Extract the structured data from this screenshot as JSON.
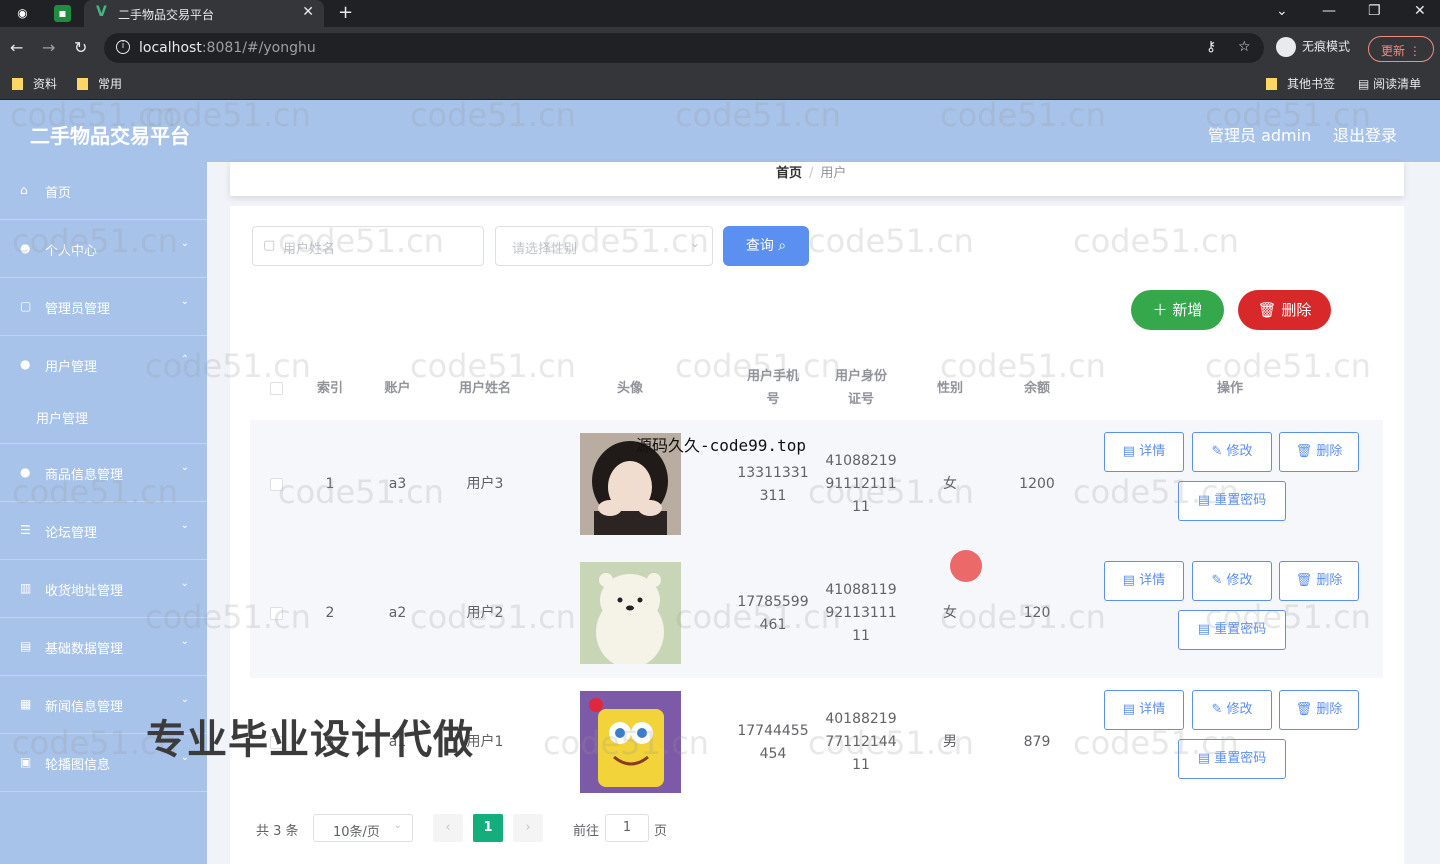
{
  "browser": {
    "tab_title": "二手物品交易平台",
    "url_host": "localhost",
    "url_rest": ":8081/#/yonghu",
    "incognito_label": "无痕模式",
    "update_label": "更新",
    "bookmarks": [
      "资料",
      "常用"
    ],
    "other_bookmarks": "其他书签",
    "reading_list": "阅读清单"
  },
  "header": {
    "title": "二手物品交易平台",
    "user": "管理员 admin",
    "logout": "退出登录"
  },
  "sidebar": {
    "items": [
      {
        "label": "首页",
        "icon": "home-icon"
      },
      {
        "label": "个人中心",
        "icon": "user-icon"
      },
      {
        "label": "管理员管理",
        "icon": "folder-icon"
      },
      {
        "label": "用户管理",
        "icon": "users-icon"
      },
      {
        "label": "商品信息管理",
        "icon": "user-icon"
      },
      {
        "label": "论坛管理",
        "icon": "list-icon"
      },
      {
        "label": "收货地址管理",
        "icon": "bar-chart-icon"
      },
      {
        "label": "基础数据管理",
        "icon": "chart-icon"
      },
      {
        "label": "新闻信息管理",
        "icon": "document-icon"
      },
      {
        "label": "轮播图信息",
        "icon": "image-icon"
      }
    ],
    "sub_item": "用户管理"
  },
  "breadcrumb": {
    "home": "首页",
    "separator": "/",
    "current": "用户"
  },
  "search": {
    "name_placeholder": "用户姓名",
    "gender_placeholder": "请选择性别",
    "query_label": "查询"
  },
  "actions": {
    "add_label": "新增",
    "delete_label": "删除"
  },
  "table": {
    "headers": {
      "index": "索引",
      "account": "账户",
      "name": "用户姓名",
      "avatar": "头像",
      "phone": [
        "用户手机",
        "号"
      ],
      "idcard": [
        "用户身份",
        "证号"
      ],
      "gender": "性别",
      "balance": "余额",
      "ops": "操作"
    },
    "rows": [
      {
        "index": "1",
        "account": "a3",
        "name": "用户3",
        "phone": [
          "13311331",
          "311"
        ],
        "idcard": [
          "41088219",
          "91112111",
          "11"
        ],
        "gender": "女",
        "balance": "1200",
        "avatar": "girl"
      },
      {
        "index": "2",
        "account": "a2",
        "name": "用户2",
        "phone": [
          "17785599",
          "461"
        ],
        "idcard": [
          "41088119",
          "92113111",
          "11"
        ],
        "gender": "女",
        "balance": "120",
        "avatar": "bear"
      },
      {
        "index": "3",
        "account": "a1",
        "name": "用户1",
        "phone": [
          "17744455",
          "454"
        ],
        "idcard": [
          "40188219",
          "77112144",
          "11"
        ],
        "gender": "男",
        "balance": "879",
        "avatar": "sponge"
      }
    ],
    "row_buttons": {
      "detail": "详情",
      "edit": "修改",
      "delete": "删除",
      "reset": "重置密码"
    }
  },
  "pagination": {
    "total": "共 3 条",
    "page_size": "10条/页",
    "current": "1",
    "goto_prefix": "前往",
    "goto_value": "1",
    "goto_suffix": "页"
  },
  "overlays": {
    "source_text": "源码久久-code99.top",
    "promo_text": "专业毕业设计代做",
    "watermark": "code51.cn"
  },
  "colors": {
    "sidebar_bg": "#a8c3ea",
    "primary": "#5b8ff0",
    "success": "#34a84a",
    "danger": "#d8282a",
    "pager_active": "#13ae7b"
  }
}
